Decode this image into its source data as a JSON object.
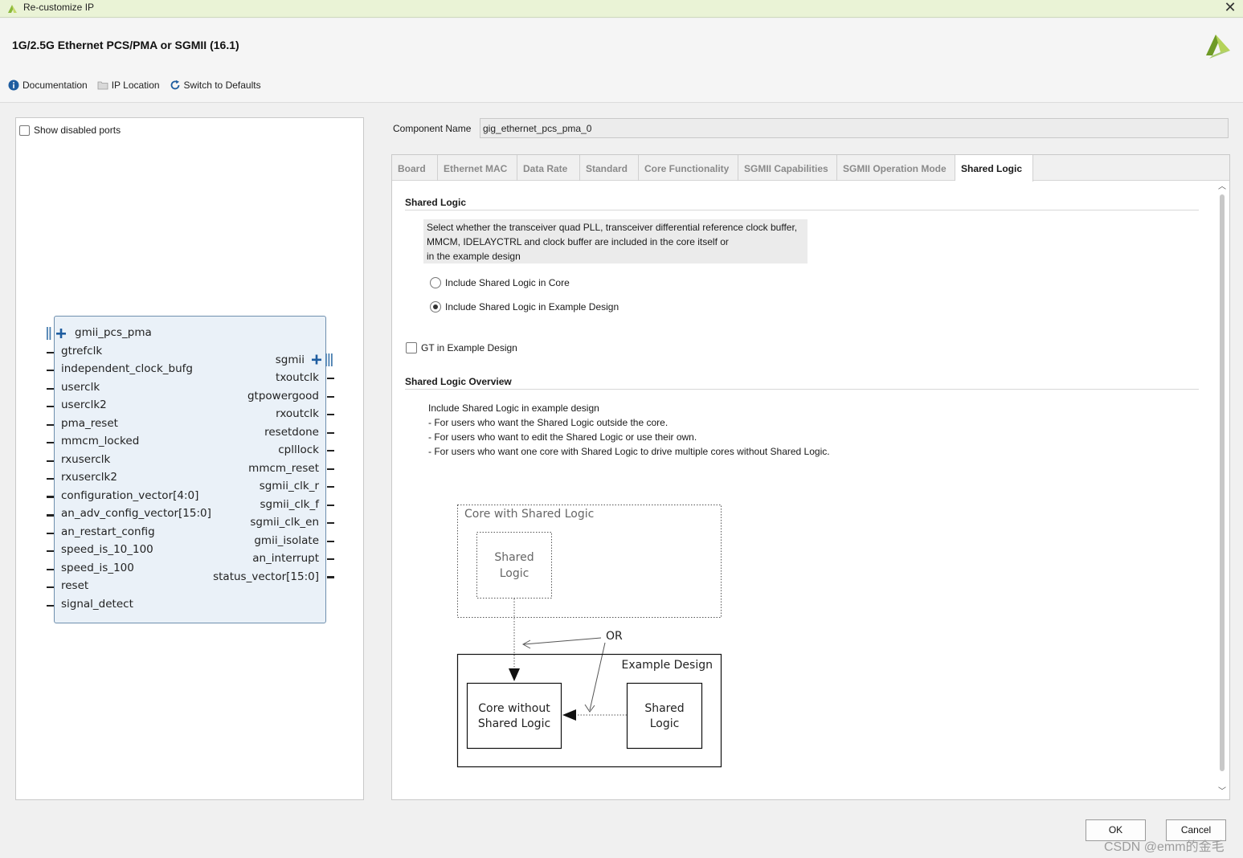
{
  "window": {
    "title": "Re-customize IP"
  },
  "header": {
    "ip_title": "1G/2.5G Ethernet PCS/PMA or SGMII (16.1)",
    "toolbar": {
      "documentation": "Documentation",
      "ip_location": "IP Location",
      "switch_defaults": "Switch to Defaults"
    }
  },
  "left_panel": {
    "show_disabled_ports": "Show disabled ports",
    "block": {
      "left_ports": [
        "gmii_pcs_pma",
        "gtrefclk",
        "independent_clock_bufg",
        "userclk",
        "userclk2",
        "pma_reset",
        "mmcm_locked",
        "rxuserclk",
        "rxuserclk2",
        "configuration_vector[4:0]",
        "an_adv_config_vector[15:0]",
        "an_restart_config",
        "speed_is_10_100",
        "speed_is_100",
        "reset",
        "signal_detect"
      ],
      "right_ports": [
        "sgmii",
        "txoutclk",
        "gtpowergood",
        "rxoutclk",
        "resetdone",
        "cplllock",
        "mmcm_reset",
        "sgmii_clk_r",
        "sgmii_clk_f",
        "sgmii_clk_en",
        "gmii_isolate",
        "an_interrupt",
        "status_vector[15:0]"
      ]
    }
  },
  "component": {
    "label": "Component Name",
    "value": "gig_ethernet_pcs_pma_0"
  },
  "tabs": [
    "Board",
    "Ethernet MAC",
    "Data Rate",
    "Standard",
    "Core Functionality",
    "SGMII Capabilities",
    "SGMII Operation Mode",
    "Shared Logic"
  ],
  "active_tab": "Shared Logic",
  "shared_logic": {
    "section_title": "Shared Logic",
    "description": [
      "Select whether the transceiver quad PLL, transceiver differential reference clock buffer,",
      "MMCM, IDELAYCTRL and clock buffer are included in the core itself or",
      "in the example design"
    ],
    "option_core": "Include Shared Logic in Core",
    "option_example": "Include Shared Logic in Example Design",
    "selected_option": "example",
    "gt_in_example": "GT in Example Design",
    "gt_in_example_checked": false
  },
  "overview": {
    "section_title": "Shared Logic Overview",
    "lines": [
      "Include Shared Logic in example design",
      "- For users who want the Shared Logic outside the core.",
      "- For users who want to edit the Shared Logic or use their own.",
      "- For users who want one core with Shared Logic to drive multiple cores without Shared Logic."
    ]
  },
  "diagram": {
    "core_with_shared": "Core with Shared Logic",
    "shared_logic_1": "Shared",
    "shared_logic_2": "Logic",
    "or_label": "OR",
    "example_design": "Example Design",
    "core_without_1": "Core without",
    "core_without_2": "Shared Logic"
  },
  "buttons": {
    "ok": "OK",
    "cancel": "Cancel"
  },
  "watermark": "CSDN @emm的金毛",
  "colors": {
    "titlebar": "#eaf3d6",
    "block_fill": "#eaf1f8",
    "block_border": "#6f8fae",
    "brand_green": "#8ab93a"
  }
}
